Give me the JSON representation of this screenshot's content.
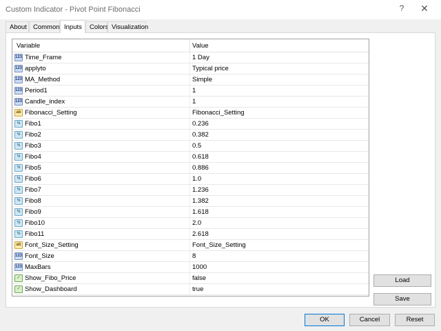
{
  "window": {
    "title": "Custom Indicator - Pivot Point Fibonacci",
    "help": "?",
    "close": "✕"
  },
  "tabs": [
    {
      "label": "About"
    },
    {
      "label": "Common"
    },
    {
      "label": "Inputs",
      "active": true
    },
    {
      "label": "Colors"
    },
    {
      "label": "Visualization"
    }
  ],
  "grid": {
    "headers": {
      "variable": "Variable",
      "value": "Value"
    },
    "rows": [
      {
        "icon": "int",
        "icon_text": "123",
        "variable": "Time_Frame",
        "value": "1 Day"
      },
      {
        "icon": "int",
        "icon_text": "123",
        "variable": "applyto",
        "value": "Typical price"
      },
      {
        "icon": "int",
        "icon_text": "123",
        "variable": "MA_Method",
        "value": "Simple"
      },
      {
        "icon": "int",
        "icon_text": "123",
        "variable": "Period1",
        "value": "1"
      },
      {
        "icon": "int",
        "icon_text": "123",
        "variable": "Candle_index",
        "value": "1"
      },
      {
        "icon": "str",
        "icon_text": "ab",
        "variable": "Fibonacci_Setting",
        "value": "Fibonacci_Setting"
      },
      {
        "icon": "dbl",
        "icon_text": "½",
        "variable": "Fibo1",
        "value": "0.236"
      },
      {
        "icon": "dbl",
        "icon_text": "½",
        "variable": "Fibo2",
        "value": "0.382"
      },
      {
        "icon": "dbl",
        "icon_text": "½",
        "variable": "Fibo3",
        "value": "0.5"
      },
      {
        "icon": "dbl",
        "icon_text": "½",
        "variable": "Fibo4",
        "value": "0.618"
      },
      {
        "icon": "dbl",
        "icon_text": "½",
        "variable": "Fibo5",
        "value": "0.886"
      },
      {
        "icon": "dbl",
        "icon_text": "½",
        "variable": "Fibo6",
        "value": "1.0"
      },
      {
        "icon": "dbl",
        "icon_text": "½",
        "variable": "Fibo7",
        "value": "1.236"
      },
      {
        "icon": "dbl",
        "icon_text": "½",
        "variable": "Fibo8",
        "value": "1.382"
      },
      {
        "icon": "dbl",
        "icon_text": "½",
        "variable": "Fibo9",
        "value": "1.618"
      },
      {
        "icon": "dbl",
        "icon_text": "½",
        "variable": "Fibo10",
        "value": "2.0"
      },
      {
        "icon": "dbl",
        "icon_text": "½",
        "variable": "Fibo11",
        "value": "2.618"
      },
      {
        "icon": "str",
        "icon_text": "ab",
        "variable": "Font_Size_Setting",
        "value": "Font_Size_Setting"
      },
      {
        "icon": "int",
        "icon_text": "123",
        "variable": "Font_Size",
        "value": "8"
      },
      {
        "icon": "int",
        "icon_text": "123",
        "variable": "MaxBars",
        "value": "1000"
      },
      {
        "icon": "bool",
        "icon_text": "✓",
        "variable": "Show_Fibo_Price",
        "value": "false"
      },
      {
        "icon": "bool",
        "icon_text": "✓",
        "variable": "Show_Dashboard",
        "value": "true"
      }
    ]
  },
  "buttons": {
    "load": "Load",
    "save": "Save",
    "ok": "OK",
    "cancel": "Cancel",
    "reset": "Reset"
  }
}
